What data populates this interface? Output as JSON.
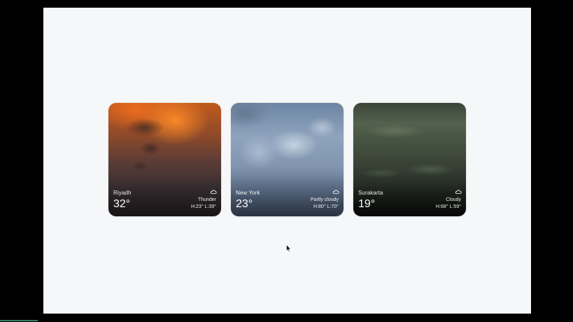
{
  "cards": [
    {
      "city": "Riyadh",
      "temp": "32°",
      "condition": "Thunder",
      "hilo": "H:23° L:39°",
      "icon": "cloud-icon"
    },
    {
      "city": "New York",
      "temp": "23°",
      "condition": "Partly cloudy",
      "hilo": "H:80° L:70°",
      "icon": "cloud-icon"
    },
    {
      "city": "Surakarta",
      "temp": "19°",
      "condition": "Cloudy",
      "hilo": "H:68° L:59°",
      "icon": "cloud-icon"
    }
  ],
  "colors": {
    "page_background": "#f6f7f9",
    "outer_frame": "#000000",
    "card_text": "#ffffff"
  }
}
